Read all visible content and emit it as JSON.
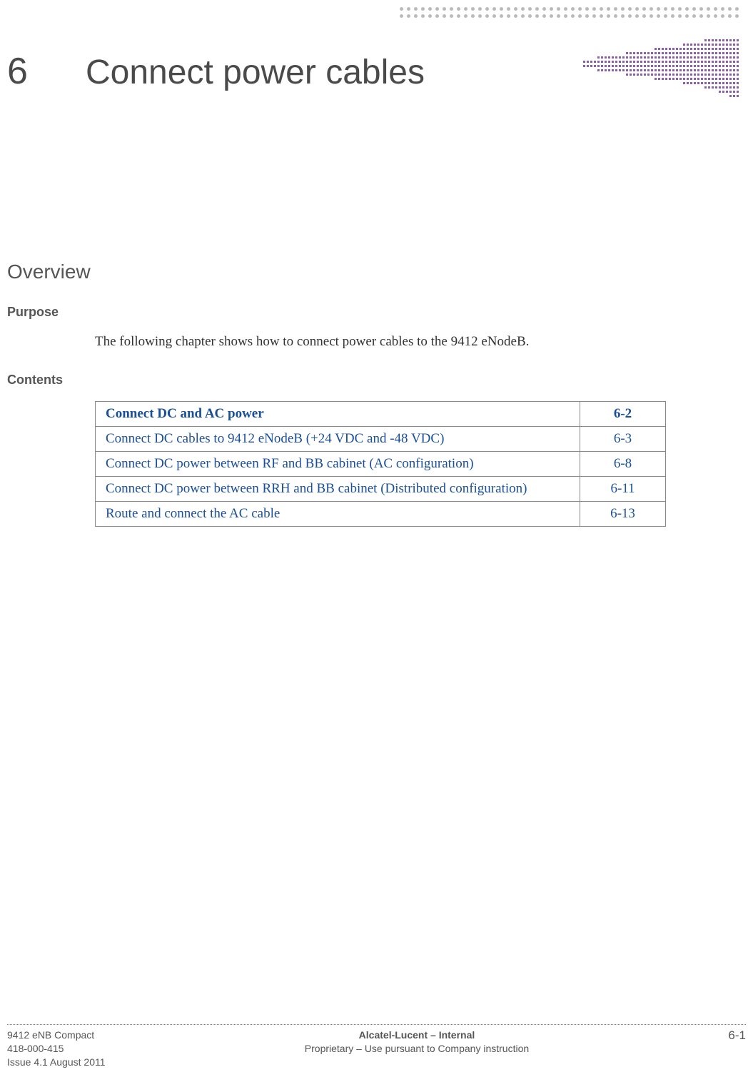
{
  "chapter": {
    "number": "6",
    "title": "Connect power cables"
  },
  "overview_heading": "Overview",
  "purpose": {
    "label": "Purpose",
    "text": "The following chapter shows how to connect power cables to the 9412 eNodeB."
  },
  "contents": {
    "label": "Contents",
    "rows": [
      {
        "title": "Connect DC and AC power",
        "page": "6-2"
      },
      {
        "title": "Connect DC cables to 9412 eNodeB (+24 VDC and -48 VDC)",
        "page": "6-3"
      },
      {
        "title": "Connect DC power between RF and BB cabinet (AC configuration)",
        "page": "6-8"
      },
      {
        "title": "Connect DC power between RRH and BB cabinet (Distributed configuration)",
        "page": "6-11"
      },
      {
        "title": "Route and connect the AC cable",
        "page": "6-13"
      }
    ]
  },
  "footer": {
    "left_line1": "9412 eNB Compact",
    "left_line2": "418-000-415",
    "left_line3": "Issue 4.1   August 2011",
    "center_line1": "Alcatel-Lucent – Internal",
    "center_line2": "Proprietary – Use pursuant to Company instruction",
    "page_number": "6-1"
  }
}
